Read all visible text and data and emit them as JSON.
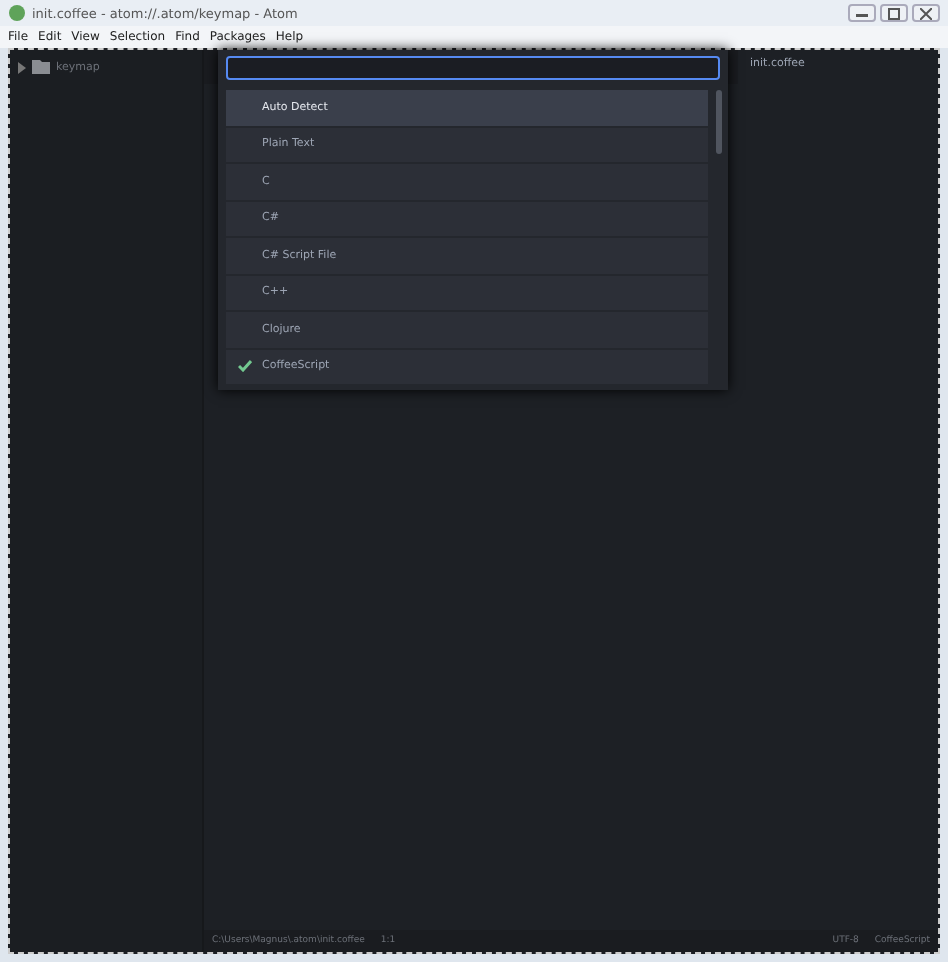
{
  "window": {
    "title": "init.coffee - atom://.atom/keymap - Atom"
  },
  "menu": [
    "File",
    "Edit",
    "View",
    "Selection",
    "Find",
    "Packages",
    "Help"
  ],
  "tree": {
    "items": [
      {
        "label": "keymap",
        "expanded": false
      }
    ]
  },
  "tab": {
    "label": "init.coffee"
  },
  "grammar_selector": {
    "items": [
      {
        "label": "Auto Detect",
        "selected": true,
        "checked": false
      },
      {
        "label": "Plain Text",
        "selected": false,
        "checked": false
      },
      {
        "label": "C",
        "selected": false,
        "checked": false
      },
      {
        "label": "C#",
        "selected": false,
        "checked": false
      },
      {
        "label": "C# Script File",
        "selected": false,
        "checked": false
      },
      {
        "label": "C++",
        "selected": false,
        "checked": false
      },
      {
        "label": "Clojure",
        "selected": false,
        "checked": false
      },
      {
        "label": "CoffeeScript",
        "selected": false,
        "checked": true
      }
    ]
  },
  "status_bar": {
    "path": "C:\\Users\\Magnus\\.atom\\init.coffee",
    "position": "1:1",
    "encoding": "UTF-8",
    "grammar": "CoffeeScript"
  }
}
